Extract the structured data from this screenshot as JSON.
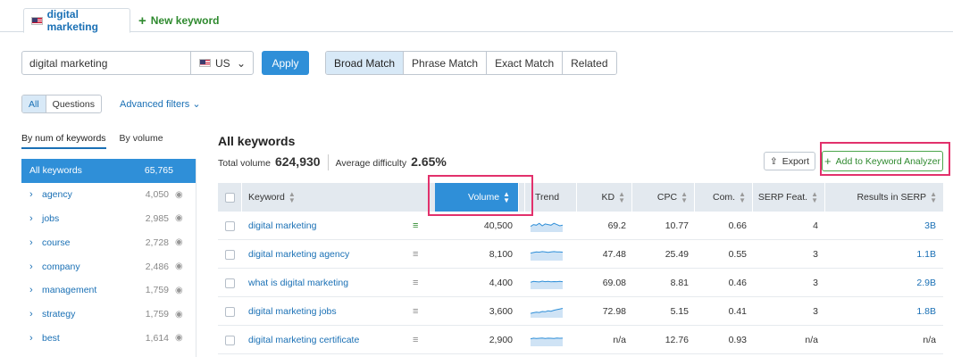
{
  "tabs": {
    "active_label": "digital marketing",
    "new_label": "New keyword"
  },
  "search": {
    "value": "digital marketing",
    "country": "US",
    "apply_label": "Apply"
  },
  "match_types": [
    {
      "label": "Broad Match",
      "active": true
    },
    {
      "label": "Phrase Match",
      "active": false
    },
    {
      "label": "Exact Match",
      "active": false
    },
    {
      "label": "Related",
      "active": false
    }
  ],
  "filter_toggle": {
    "all": "All",
    "questions": "Questions"
  },
  "advanced_filters": "Advanced filters",
  "side_tabs": {
    "by_num": "By num of keywords",
    "by_volume": "By volume"
  },
  "side_items": [
    {
      "label": "All keywords",
      "count": "65,765"
    },
    {
      "label": "agency",
      "count": "4,050"
    },
    {
      "label": "jobs",
      "count": "2,985"
    },
    {
      "label": "course",
      "count": "2,728"
    },
    {
      "label": "company",
      "count": "2,486"
    },
    {
      "label": "management",
      "count": "1,759"
    },
    {
      "label": "strategy",
      "count": "1,759"
    },
    {
      "label": "best",
      "count": "1,614"
    }
  ],
  "main": {
    "heading": "All keywords",
    "total_volume_label": "Total volume",
    "total_volume": "624,930",
    "avg_difficulty_label": "Average difficulty",
    "avg_difficulty": "2.65%",
    "export_label": "Export",
    "add_to_analyzer_label": "Add to Keyword Analyzer"
  },
  "table": {
    "columns": [
      "Keyword",
      "Volume",
      "Trend",
      "KD",
      "CPC",
      "Com.",
      "SERP Feat.",
      "Results in SERP"
    ],
    "rows": [
      {
        "keyword": "digital marketing",
        "volume": "40,500",
        "trend": [
          0.45,
          0.6,
          0.55,
          0.7,
          0.5,
          0.65,
          0.6,
          0.55,
          0.7,
          0.6,
          0.5,
          0.55
        ],
        "kd": "69.2",
        "cpc": "10.77",
        "com": "0.66",
        "serp": "4",
        "results": "3B",
        "added": true
      },
      {
        "keyword": "digital marketing agency",
        "volume": "8,100",
        "trend": [
          0.6,
          0.65,
          0.7,
          0.68,
          0.72,
          0.7,
          0.66,
          0.7,
          0.72,
          0.69,
          0.7,
          0.68
        ],
        "kd": "47.48",
        "cpc": "25.49",
        "com": "0.55",
        "serp": "3",
        "results": "1.1B",
        "added": false
      },
      {
        "keyword": "what is digital marketing",
        "volume": "4,400",
        "trend": [
          0.55,
          0.62,
          0.6,
          0.58,
          0.64,
          0.6,
          0.62,
          0.59,
          0.61,
          0.6,
          0.63,
          0.6
        ],
        "kd": "69.08",
        "cpc": "8.81",
        "com": "0.46",
        "serp": "3",
        "results": "2.9B",
        "added": false
      },
      {
        "keyword": "digital marketing jobs",
        "volume": "3,600",
        "trend": [
          0.35,
          0.4,
          0.45,
          0.42,
          0.5,
          0.48,
          0.55,
          0.52,
          0.6,
          0.65,
          0.7,
          0.75
        ],
        "kd": "72.98",
        "cpc": "5.15",
        "com": "0.41",
        "serp": "3",
        "results": "1.8B",
        "added": false
      },
      {
        "keyword": "digital marketing certificate",
        "volume": "2,900",
        "trend": [
          0.6,
          0.65,
          0.62,
          0.64,
          0.66,
          0.63,
          0.65,
          0.64,
          0.62,
          0.66,
          0.64,
          0.65
        ],
        "kd": "n/a",
        "cpc": "12.76",
        "com": "0.93",
        "serp": "n/a",
        "results": "n/a",
        "added": false
      }
    ]
  },
  "colors": {
    "accent": "#2f8fd8",
    "link": "#1a70b5",
    "green": "#2f8a2f",
    "highlight": "#e2316c"
  }
}
